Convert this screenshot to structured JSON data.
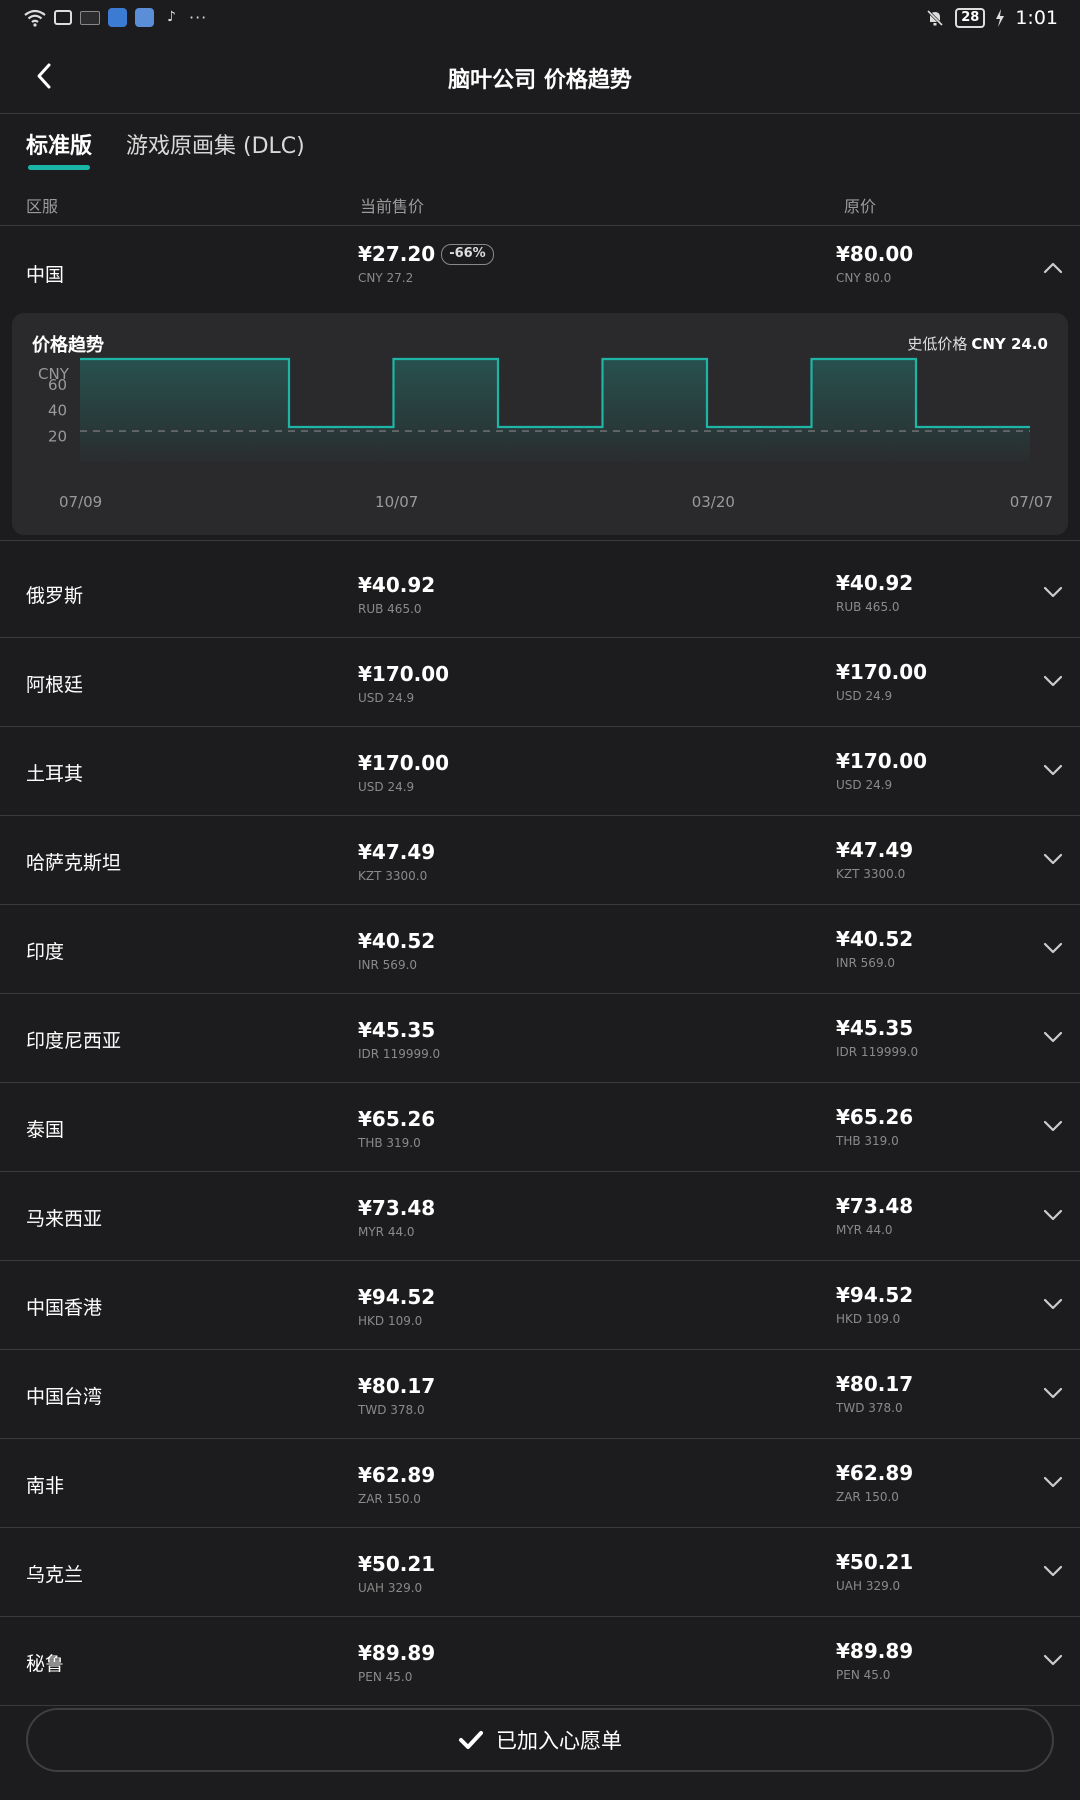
{
  "status_bar": {
    "time": "1:01",
    "battery": "28",
    "tiktok_glyph": "♪",
    "dots": "···",
    "icons": [
      "wifi-icon",
      "bilibili-icon",
      "notification-icon",
      "browser-icon",
      "app-icon",
      "tiktok-icon",
      "more-icon",
      "mute-icon",
      "battery-icon",
      "charging-icon"
    ]
  },
  "nav": {
    "title": "脑叶公司 价格趋势",
    "back_icon": "chevron-left-icon"
  },
  "tabs": [
    {
      "label": "标准版",
      "active": true
    },
    {
      "label": "游戏原画集 (DLC)",
      "active": false
    }
  ],
  "columns": {
    "region": "区服",
    "current": "当前售价",
    "original": "原价"
  },
  "rows": [
    {
      "region": "中国",
      "price": "¥27.20",
      "discount": "-66%",
      "price_sub": "CNY 27.2",
      "orig": "¥80.00",
      "orig_sub": "CNY 80.0",
      "expanded": true
    },
    {
      "region": "俄罗斯",
      "price": "¥40.92",
      "price_sub": "RUB 465.0",
      "orig": "¥40.92",
      "orig_sub": "RUB 465.0"
    },
    {
      "region": "阿根廷",
      "price": "¥170.00",
      "price_sub": "USD 24.9",
      "orig": "¥170.00",
      "orig_sub": "USD 24.9"
    },
    {
      "region": "土耳其",
      "price": "¥170.00",
      "price_sub": "USD 24.9",
      "orig": "¥170.00",
      "orig_sub": "USD 24.9"
    },
    {
      "region": "哈萨克斯坦",
      "price": "¥47.49",
      "price_sub": "KZT 3300.0",
      "orig": "¥47.49",
      "orig_sub": "KZT 3300.0"
    },
    {
      "region": "印度",
      "price": "¥40.52",
      "price_sub": "INR 569.0",
      "orig": "¥40.52",
      "orig_sub": "INR 569.0"
    },
    {
      "region": "印度尼西亚",
      "price": "¥45.35",
      "price_sub": "IDR 119999.0",
      "orig": "¥45.35",
      "orig_sub": "IDR 119999.0"
    },
    {
      "region": "泰国",
      "price": "¥65.26",
      "price_sub": "THB 319.0",
      "orig": "¥65.26",
      "orig_sub": "THB 319.0"
    },
    {
      "region": "马来西亚",
      "price": "¥73.48",
      "price_sub": "MYR 44.0",
      "orig": "¥73.48",
      "orig_sub": "MYR 44.0"
    },
    {
      "region": "中国香港",
      "price": "¥94.52",
      "price_sub": "HKD 109.0",
      "orig": "¥94.52",
      "orig_sub": "HKD 109.0"
    },
    {
      "region": "中国台湾",
      "price": "¥80.17",
      "price_sub": "TWD 378.0",
      "orig": "¥80.17",
      "orig_sub": "TWD 378.0"
    },
    {
      "region": "南非",
      "price": "¥62.89",
      "price_sub": "ZAR 150.0",
      "orig": "¥62.89",
      "orig_sub": "ZAR 150.0"
    },
    {
      "region": "乌克兰",
      "price": "¥50.21",
      "price_sub": "UAH 329.0",
      "orig": "¥50.21",
      "orig_sub": "UAH 329.0"
    },
    {
      "region": "秘鲁",
      "price": "¥89.89",
      "price_sub": "PEN 45.0",
      "orig": "¥89.89",
      "orig_sub": "PEN 45.0"
    }
  ],
  "trend": {
    "title": "价格趋势",
    "low_label": "史低价格",
    "low_value": "CNY 24.0"
  },
  "chart_data": {
    "type": "line",
    "step": true,
    "ylabel": "CNY",
    "yticks": [
      20,
      40,
      60
    ],
    "ylim": [
      0,
      80
    ],
    "xticks": [
      "07/09",
      "10/07",
      "03/20",
      "07/07"
    ],
    "x": [
      0,
      0.22,
      0.22,
      0.33,
      0.33,
      0.44,
      0.44,
      0.55,
      0.55,
      0.66,
      0.66,
      0.77,
      0.77,
      0.88,
      0.88,
      1.0
    ],
    "values": [
      80,
      80,
      27.2,
      27.2,
      80,
      80,
      27.2,
      27.2,
      80,
      80,
      27.2,
      27.2,
      80,
      80,
      27.2,
      27.2
    ],
    "reference_line": 24,
    "line_color": "#1fb5a6"
  },
  "footer": {
    "wishlist_label": "已加入心愿单",
    "check_icon": "check-icon"
  }
}
